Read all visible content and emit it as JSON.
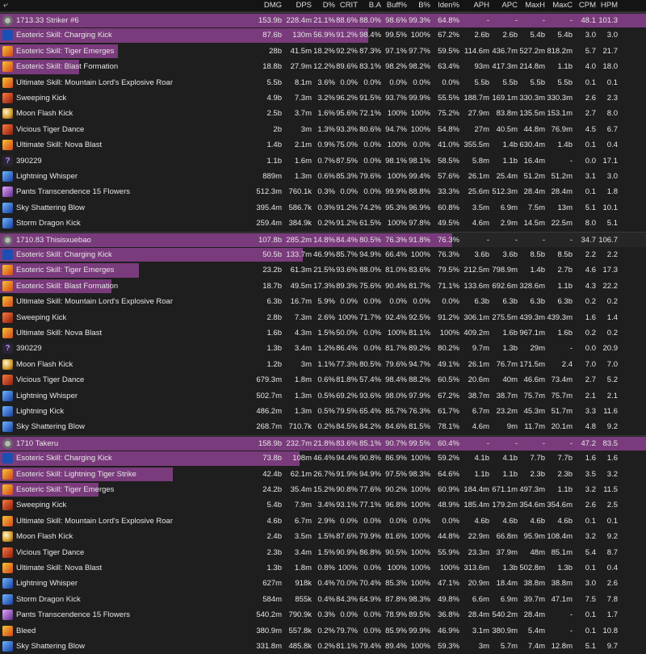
{
  "header": {
    "back_icon": "back-arrow-icon",
    "columns": [
      "DMG",
      "DPS",
      "D%",
      "CRIT",
      "B.A",
      "Buff%",
      "B%",
      "Iden%",
      "APH",
      "APC",
      "MaxH",
      "MaxC",
      "CPM",
      "HPM"
    ]
  },
  "colors": {
    "bar": "#7a3b7c",
    "background": "#1e1e1e"
  },
  "rows": [
    {
      "kind": "player",
      "icon": "player-icon",
      "name": "1713.33 Striker #6",
      "bar": 1.0,
      "v": [
        "153.9b",
        "228.4m",
        "21.1%",
        "88.6%",
        "88.0%",
        "98.6%",
        "99.3%",
        "64.8%",
        "-",
        "-",
        "-",
        "-",
        "48.1",
        "101.3"
      ]
    },
    {
      "kind": "skill",
      "icon": "esoteric",
      "name": "Esoteric Skill: Charging Kick",
      "bar": 0.57,
      "v": [
        "87.6b",
        "130m",
        "56.9%",
        "91.2%",
        "98.4%",
        "99.5%",
        "100%",
        "67.2%",
        "2.6b",
        "2.6b",
        "5.4b",
        "5.4b",
        "3.0",
        "3.0"
      ]
    },
    {
      "kind": "skill",
      "icon": "fire",
      "name": "Esoteric Skill: Tiger Emerges",
      "bar": 0.182,
      "v": [
        "28b",
        "41.5m",
        "18.2%",
        "92.2%",
        "87.3%",
        "97.1%",
        "97.7%",
        "59.5%",
        "114.6m",
        "436.7m",
        "527.2m",
        "818.2m",
        "5.7",
        "21.7"
      ]
    },
    {
      "kind": "skill",
      "icon": "fire",
      "name": "Esoteric Skill: Blast Formation",
      "bar": 0.122,
      "v": [
        "18.8b",
        "27.9m",
        "12.2%",
        "89.6%",
        "83.1%",
        "98.2%",
        "98.2%",
        "63.4%",
        "93m",
        "417.3m",
        "214.8m",
        "1.1b",
        "4.0",
        "18.0"
      ]
    },
    {
      "kind": "skill",
      "icon": "fire",
      "name": "Ultimate Skill: Mountain Lord's Explosive Roar",
      "bar": 0,
      "v": [
        "5.5b",
        "8.1m",
        "3.6%",
        "0.0%",
        "0.0%",
        "0.0%",
        "0.0%",
        "0.0%",
        "5.5b",
        "5.5b",
        "5.5b",
        "5.5b",
        "0.1",
        "0.1"
      ]
    },
    {
      "kind": "skill",
      "icon": "red",
      "name": "Sweeping Kick",
      "bar": 0,
      "v": [
        "4.9b",
        "7.3m",
        "3.2%",
        "96.2%",
        "91.5%",
        "93.7%",
        "99.9%",
        "55.5%",
        "188.7m",
        "169.1m",
        "330.3m",
        "330.3m",
        "2.6",
        "2.3"
      ]
    },
    {
      "kind": "skill",
      "icon": "moon",
      "name": "Moon Flash Kick",
      "bar": 0,
      "v": [
        "2.5b",
        "3.7m",
        "1.6%",
        "95.6%",
        "72.1%",
        "100%",
        "100%",
        "75.2%",
        "27.9m",
        "83.8m",
        "135.5m",
        "153.1m",
        "2.7",
        "8.0"
      ]
    },
    {
      "kind": "skill",
      "icon": "red",
      "name": "Vicious Tiger Dance",
      "bar": 0,
      "v": [
        "2b",
        "3m",
        "1.3%",
        "93.3%",
        "80.6%",
        "94.7%",
        "100%",
        "54.8%",
        "27m",
        "40.5m",
        "44.8m",
        "76.9m",
        "4.5",
        "6.7"
      ]
    },
    {
      "kind": "skill",
      "icon": "fire",
      "name": "Ultimate Skill: Nova Blast",
      "bar": 0,
      "v": [
        "1.4b",
        "2.1m",
        "0.9%",
        "75.0%",
        "0.0%",
        "100%",
        "0.0%",
        "41.0%",
        "355.5m",
        "1.4b",
        "630.4m",
        "1.4b",
        "0.1",
        "0.4"
      ]
    },
    {
      "kind": "skill",
      "icon": "unknown",
      "name": "390229",
      "bar": 0,
      "v": [
        "1.1b",
        "1.6m",
        "0.7%",
        "87.5%",
        "0.0%",
        "98.1%",
        "98.1%",
        "58.5%",
        "5.8m",
        "1.1b",
        "16.4m",
        "-",
        "0.0",
        "17.1"
      ]
    },
    {
      "kind": "skill",
      "icon": "blue",
      "name": "Lightning Whisper",
      "bar": 0,
      "v": [
        "889m",
        "1.3m",
        "0.6%",
        "85.3%",
        "79.6%",
        "100%",
        "99.4%",
        "57.6%",
        "26.1m",
        "25.4m",
        "51.2m",
        "51.2m",
        "3.1",
        "3.0"
      ]
    },
    {
      "kind": "skill",
      "icon": "purple",
      "name": "Pants Transcendence 15 Flowers",
      "bar": 0,
      "v": [
        "512.3m",
        "760.1k",
        "0.3%",
        "0.0%",
        "0.0%",
        "99.9%",
        "88.8%",
        "33.3%",
        "25.6m",
        "512.3m",
        "28.4m",
        "28.4m",
        "0.1",
        "1.8"
      ]
    },
    {
      "kind": "skill",
      "icon": "blue",
      "name": "Sky Shattering Blow",
      "bar": 0,
      "v": [
        "395.4m",
        "586.7k",
        "0.3%",
        "91.2%",
        "74.2%",
        "95.3%",
        "96.9%",
        "60.8%",
        "3.5m",
        "6.9m",
        "7.5m",
        "13m",
        "5.1",
        "10.1"
      ]
    },
    {
      "kind": "skill",
      "icon": "blue",
      "name": "Storm Dragon Kick",
      "bar": 0,
      "v": [
        "259.4m",
        "384.9k",
        "0.2%",
        "91.2%",
        "61.5%",
        "100%",
        "97.8%",
        "49.5%",
        "4.6m",
        "2.9m",
        "14.5m",
        "22.5m",
        "8.0",
        "5.1"
      ]
    },
    {
      "kind": "player",
      "icon": "player-icon",
      "name": "1710.83 Thisisxuebao",
      "bar": 0.7,
      "v": [
        "107.8b",
        "285.2m",
        "14.8%",
        "84.4%",
        "80.5%",
        "76.3%",
        "91.8%",
        "76.3%",
        "-",
        "-",
        "-",
        "-",
        "34.7",
        "106.7"
      ]
    },
    {
      "kind": "skill",
      "icon": "esoteric",
      "name": "Esoteric Skill: Charging Kick",
      "bar": 0.469,
      "v": [
        "50.5b",
        "133.7m",
        "46.9%",
        "85.7%",
        "94.9%",
        "66.4%",
        "100%",
        "76.3%",
        "3.6b",
        "3.6b",
        "8.5b",
        "8.5b",
        "2.2",
        "2.2"
      ]
    },
    {
      "kind": "skill",
      "icon": "fire",
      "name": "Esoteric Skill: Tiger Emerges",
      "bar": 0.215,
      "v": [
        "23.2b",
        "61.3m",
        "21.5%",
        "93.6%",
        "88.0%",
        "81.0%",
        "83.6%",
        "79.5%",
        "212.5m",
        "798.9m",
        "1.4b",
        "2.7b",
        "4.6",
        "17.3"
      ]
    },
    {
      "kind": "skill",
      "icon": "fire",
      "name": "Esoteric Skill: Blast Formation",
      "bar": 0.173,
      "v": [
        "18.7b",
        "49.5m",
        "17.3%",
        "89.3%",
        "75.6%",
        "90.4%",
        "81.7%",
        "71.1%",
        "133.6m",
        "692.6m",
        "328.6m",
        "1.1b",
        "4.3",
        "22.2"
      ]
    },
    {
      "kind": "skill",
      "icon": "fire",
      "name": "Ultimate Skill: Mountain Lord's Explosive Roar",
      "bar": 0,
      "v": [
        "6.3b",
        "16.7m",
        "5.9%",
        "0.0%",
        "0.0%",
        "0.0%",
        "0.0%",
        "0.0%",
        "6.3b",
        "6.3b",
        "6.3b",
        "6.3b",
        "0.2",
        "0.2"
      ]
    },
    {
      "kind": "skill",
      "icon": "red",
      "name": "Sweeping Kick",
      "bar": 0,
      "v": [
        "2.8b",
        "7.3m",
        "2.6%",
        "100%",
        "71.7%",
        "92.4%",
        "92.5%",
        "91.2%",
        "306.1m",
        "275.5m",
        "439.3m",
        "439.3m",
        "1.6",
        "1.4"
      ]
    },
    {
      "kind": "skill",
      "icon": "fire",
      "name": "Ultimate Skill: Nova Blast",
      "bar": 0,
      "v": [
        "1.6b",
        "4.3m",
        "1.5%",
        "50.0%",
        "0.0%",
        "100%",
        "81.1%",
        "100%",
        "409.2m",
        "1.6b",
        "967.1m",
        "1.6b",
        "0.2",
        "0.2"
      ]
    },
    {
      "kind": "skill",
      "icon": "unknown",
      "name": "390229",
      "bar": 0,
      "v": [
        "1.3b",
        "3.4m",
        "1.2%",
        "86.4%",
        "0.0%",
        "81.7%",
        "89.2%",
        "80.2%",
        "9.7m",
        "1.3b",
        "29m",
        "-",
        "0.0",
        "20.9"
      ]
    },
    {
      "kind": "skill",
      "icon": "moon",
      "name": "Moon Flash Kick",
      "bar": 0,
      "v": [
        "1.2b",
        "3m",
        "1.1%",
        "77.3%",
        "80.5%",
        "79.6%",
        "94.7%",
        "49.1%",
        "26.1m",
        "76.7m",
        "171.5m",
        "2.4",
        "7.0",
        "7.0"
      ]
    },
    {
      "kind": "skill",
      "icon": "red",
      "name": "Vicious Tiger Dance",
      "bar": 0,
      "v": [
        "679.3m",
        "1.8m",
        "0.6%",
        "81.8%",
        "57.4%",
        "98.4%",
        "88.2%",
        "60.5%",
        "20.6m",
        "40m",
        "46.6m",
        "73.4m",
        "2.7",
        "5.2"
      ]
    },
    {
      "kind": "skill",
      "icon": "blue",
      "name": "Lightning Whisper",
      "bar": 0,
      "v": [
        "502.7m",
        "1.3m",
        "0.5%",
        "69.2%",
        "93.6%",
        "98.0%",
        "97.9%",
        "67.2%",
        "38.7m",
        "38.7m",
        "75.7m",
        "75.7m",
        "2.1",
        "2.1"
      ]
    },
    {
      "kind": "skill",
      "icon": "blue",
      "name": "Lightning Kick",
      "bar": 0,
      "v": [
        "486.2m",
        "1.3m",
        "0.5%",
        "79.5%",
        "65.4%",
        "85.7%",
        "76.3%",
        "61.7%",
        "6.7m",
        "23.2m",
        "45.3m",
        "51.7m",
        "3.3",
        "11.6"
      ]
    },
    {
      "kind": "skill",
      "icon": "blue",
      "name": "Sky Shattering Blow",
      "bar": 0,
      "v": [
        "268.7m",
        "710.7k",
        "0.2%",
        "84.5%",
        "84.2%",
        "84.6%",
        "81.5%",
        "78.1%",
        "4.6m",
        "9m",
        "11.7m",
        "20.1m",
        "4.8",
        "9.2"
      ]
    },
    {
      "kind": "player",
      "icon": "player-icon",
      "name": "1710 Takeru",
      "bar": 1.0,
      "v": [
        "158.9b",
        "232.7m",
        "21.8%",
        "83.6%",
        "85.1%",
        "90.7%",
        "99.5%",
        "60.4%",
        "-",
        "-",
        "-",
        "-",
        "47.2",
        "83.5"
      ]
    },
    {
      "kind": "skill",
      "icon": "esoteric",
      "name": "Esoteric Skill: Charging Kick",
      "bar": 0.464,
      "v": [
        "73.8b",
        "108m",
        "46.4%",
        "94.4%",
        "90.8%",
        "86.9%",
        "100%",
        "59.2%",
        "4.1b",
        "4.1b",
        "7.7b",
        "7.7b",
        "1.6",
        "1.6"
      ]
    },
    {
      "kind": "skill",
      "icon": "fire",
      "name": "Esoteric Skill: Lightning Tiger Strike",
      "bar": 0.267,
      "v": [
        "42.4b",
        "62.1m",
        "26.7%",
        "91.9%",
        "94.9%",
        "97.5%",
        "98.3%",
        "64.6%",
        "1.1b",
        "1.1b",
        "2.3b",
        "2.3b",
        "3.5",
        "3.2"
      ]
    },
    {
      "kind": "skill",
      "icon": "fire",
      "name": "Esoteric Skill: Tiger Emerges",
      "bar": 0.152,
      "v": [
        "24.2b",
        "35.4m",
        "15.2%",
        "90.8%",
        "77.6%",
        "90.2%",
        "100%",
        "60.9%",
        "184.4m",
        "671.1m",
        "497.3m",
        "1.1b",
        "3.2",
        "11.5"
      ]
    },
    {
      "kind": "skill",
      "icon": "red",
      "name": "Sweeping Kick",
      "bar": 0,
      "v": [
        "5.4b",
        "7.9m",
        "3.4%",
        "93.1%",
        "77.1%",
        "96.8%",
        "100%",
        "48.9%",
        "185.4m",
        "179.2m",
        "354.6m",
        "354.6m",
        "2.6",
        "2.5"
      ]
    },
    {
      "kind": "skill",
      "icon": "fire",
      "name": "Ultimate Skill: Mountain Lord's Explosive Roar",
      "bar": 0,
      "v": [
        "4.6b",
        "6.7m",
        "2.9%",
        "0.0%",
        "0.0%",
        "0.0%",
        "0.0%",
        "0.0%",
        "4.6b",
        "4.6b",
        "4.6b",
        "4.6b",
        "0.1",
        "0.1"
      ]
    },
    {
      "kind": "skill",
      "icon": "moon",
      "name": "Moon Flash Kick",
      "bar": 0,
      "v": [
        "2.4b",
        "3.5m",
        "1.5%",
        "87.6%",
        "79.9%",
        "81.6%",
        "100%",
        "44.8%",
        "22.9m",
        "66.8m",
        "95.9m",
        "108.4m",
        "3.2",
        "9.2"
      ]
    },
    {
      "kind": "skill",
      "icon": "red",
      "name": "Vicious Tiger Dance",
      "bar": 0,
      "v": [
        "2.3b",
        "3.4m",
        "1.5%",
        "90.9%",
        "86.8%",
        "90.5%",
        "100%",
        "55.9%",
        "23.3m",
        "37.9m",
        "48m",
        "85.1m",
        "5.4",
        "8.7"
      ]
    },
    {
      "kind": "skill",
      "icon": "fire",
      "name": "Ultimate Skill: Nova Blast",
      "bar": 0,
      "v": [
        "1.3b",
        "1.8m",
        "0.8%",
        "100%",
        "0.0%",
        "100%",
        "100%",
        "100%",
        "313.6m",
        "1.3b",
        "502.8m",
        "1.3b",
        "0.1",
        "0.4"
      ]
    },
    {
      "kind": "skill",
      "icon": "blue",
      "name": "Lightning Whisper",
      "bar": 0,
      "v": [
        "627m",
        "918k",
        "0.4%",
        "70.0%",
        "70.4%",
        "85.3%",
        "100%",
        "47.1%",
        "20.9m",
        "18.4m",
        "38.8m",
        "38.8m",
        "3.0",
        "2.6"
      ]
    },
    {
      "kind": "skill",
      "icon": "blue",
      "name": "Storm Dragon Kick",
      "bar": 0,
      "v": [
        "584m",
        "855k",
        "0.4%",
        "84.3%",
        "64.9%",
        "87.8%",
        "98.3%",
        "49.8%",
        "6.6m",
        "6.9m",
        "39.7m",
        "47.1m",
        "7.5",
        "7.8"
      ]
    },
    {
      "kind": "skill",
      "icon": "purple",
      "name": "Pants Transcendence 15 Flowers",
      "bar": 0,
      "v": [
        "540.2m",
        "790.9k",
        "0.3%",
        "0.0%",
        "0.0%",
        "78.9%",
        "89.5%",
        "36.8%",
        "28.4m",
        "540.2m",
        "28.4m",
        "-",
        "0.1",
        "1.7"
      ]
    },
    {
      "kind": "skill",
      "icon": "fire",
      "name": "Bleed",
      "bar": 0,
      "v": [
        "380.9m",
        "557.8k",
        "0.2%",
        "79.7%",
        "0.0%",
        "85.9%",
        "99.9%",
        "46.9%",
        "3.1m",
        "380.9m",
        "5.4m",
        "-",
        "0.1",
        "10.8"
      ]
    },
    {
      "kind": "skill",
      "icon": "blue",
      "name": "Sky Shattering Blow",
      "bar": 0,
      "v": [
        "331.8m",
        "485.8k",
        "0.2%",
        "81.1%",
        "79.4%",
        "89.4%",
        "100%",
        "59.3%",
        "3m",
        "5.7m",
        "7.4m",
        "12.8m",
        "5.1",
        "9.7"
      ]
    }
  ]
}
